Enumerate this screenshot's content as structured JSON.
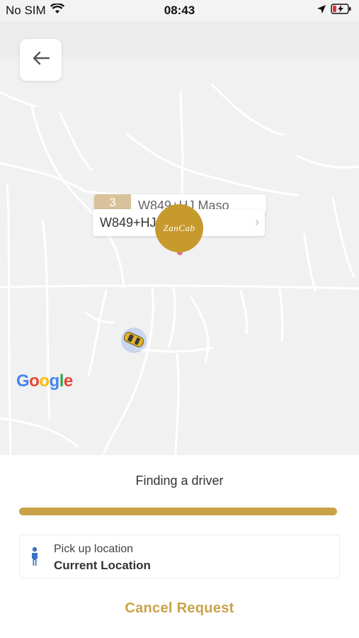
{
  "status_bar": {
    "carrier": "No SIM",
    "time": "08:43",
    "icons": [
      "wifi-icon",
      "location-arrow-icon",
      "battery-charging-icon"
    ]
  },
  "map": {
    "back_icon": "arrow-left-icon",
    "label_back": {
      "number": "3",
      "text": "W849+HJ Maso"
    },
    "label_front": {
      "text": "W849+HJ, , Tan...",
      "chevron": "›"
    },
    "pin_logo": "ZanCab",
    "provider_logo": "Google",
    "brand_color": "#c79a2e"
  },
  "sheet": {
    "status_text": "Finding a driver",
    "progress": 1.0,
    "pickup": {
      "label": "Pick up location",
      "value": "Current Location",
      "icon": "person-icon"
    },
    "cancel_label": "Cancel Request",
    "accent_color": "#c9a347"
  }
}
